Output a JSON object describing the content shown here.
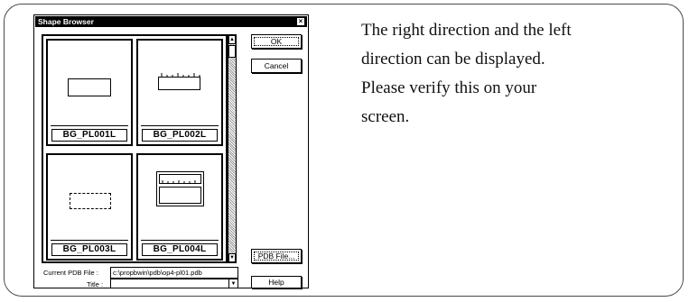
{
  "dialog": {
    "title": "Shape Browser",
    "close_label": "×",
    "shapes": [
      {
        "label": "BG_PL001L"
      },
      {
        "label": "BG_PL002L"
      },
      {
        "label": "BG_PL003L"
      },
      {
        "label": "BG_PL004L"
      }
    ],
    "ok_label": "OK",
    "cancel_label": "Cancel",
    "pdb_file_label": "PDB File...",
    "help_label": "Help",
    "current_pdb_label": "Current PDB File :",
    "current_pdb_value": "c:\\propbwin\\pdb\\op4-pl01.pdb",
    "title_field_label": "Title :",
    "title_field_value": ""
  },
  "caption": {
    "lines": [
      "The right direction and the left",
      "direction can be displayed.",
      "Please verify this on your",
      "screen."
    ]
  }
}
